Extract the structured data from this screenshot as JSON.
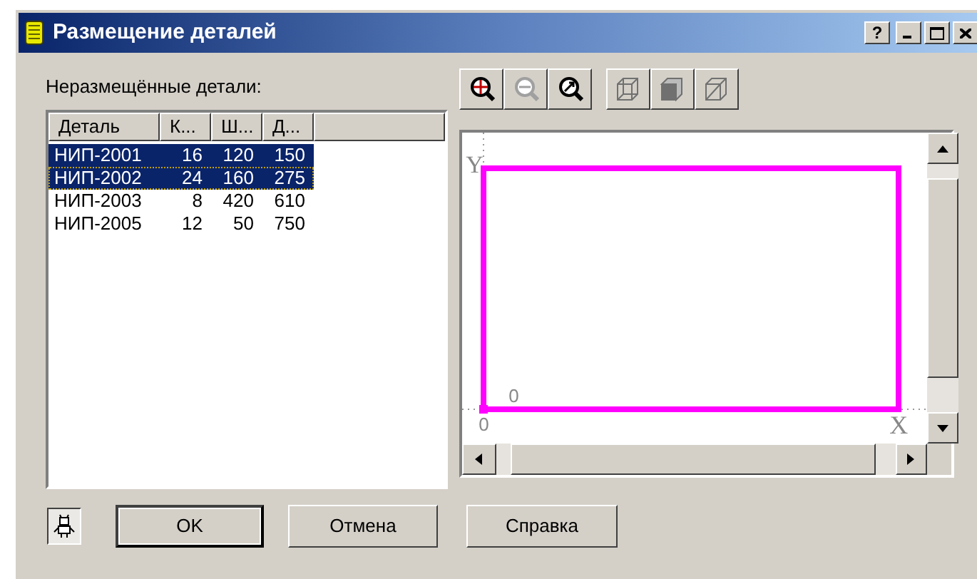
{
  "window": {
    "title": "Размещение деталей",
    "buttons": [
      {
        "kind": "help",
        "label": "?"
      },
      {
        "kind": "minimize"
      },
      {
        "kind": "maximize"
      },
      {
        "kind": "close"
      }
    ]
  },
  "parts_list": {
    "label": "Неразмещённые детали:",
    "columns": [
      "Деталь",
      "К...",
      "Ш...",
      "Д..."
    ],
    "rows": [
      {
        "cells": [
          "НИП-2001",
          "16",
          "120",
          "150"
        ],
        "selected": true,
        "focused": false
      },
      {
        "cells": [
          "НИП-2002",
          "24",
          "160",
          "275"
        ],
        "selected": true,
        "focused": true
      },
      {
        "cells": [
          "НИП-2003",
          "8",
          "420",
          "610"
        ],
        "selected": false,
        "focused": false
      },
      {
        "cells": [
          "НИП-2005",
          "12",
          "50",
          "750"
        ],
        "selected": false,
        "focused": false
      }
    ]
  },
  "toolbar": [
    {
      "kind": "zoom-in",
      "disabled": false
    },
    {
      "kind": "zoom-out",
      "disabled": true
    },
    {
      "kind": "zoom-fit",
      "disabled": false
    },
    {
      "kind": "cube-wire",
      "disabled": false
    },
    {
      "kind": "cube-solid",
      "disabled": false
    },
    {
      "kind": "cube-half",
      "disabled": false
    }
  ],
  "canvas": {
    "y_axis": "Y",
    "x_axis": "X",
    "origin_label": "0",
    "x_zero": "0"
  },
  "footer": {
    "toggle": {
      "pressed": true
    },
    "buttons": [
      {
        "label": "OK",
        "default": true
      },
      {
        "label": "Отмена",
        "default": false
      },
      {
        "label": "Справка",
        "default": false
      }
    ]
  }
}
